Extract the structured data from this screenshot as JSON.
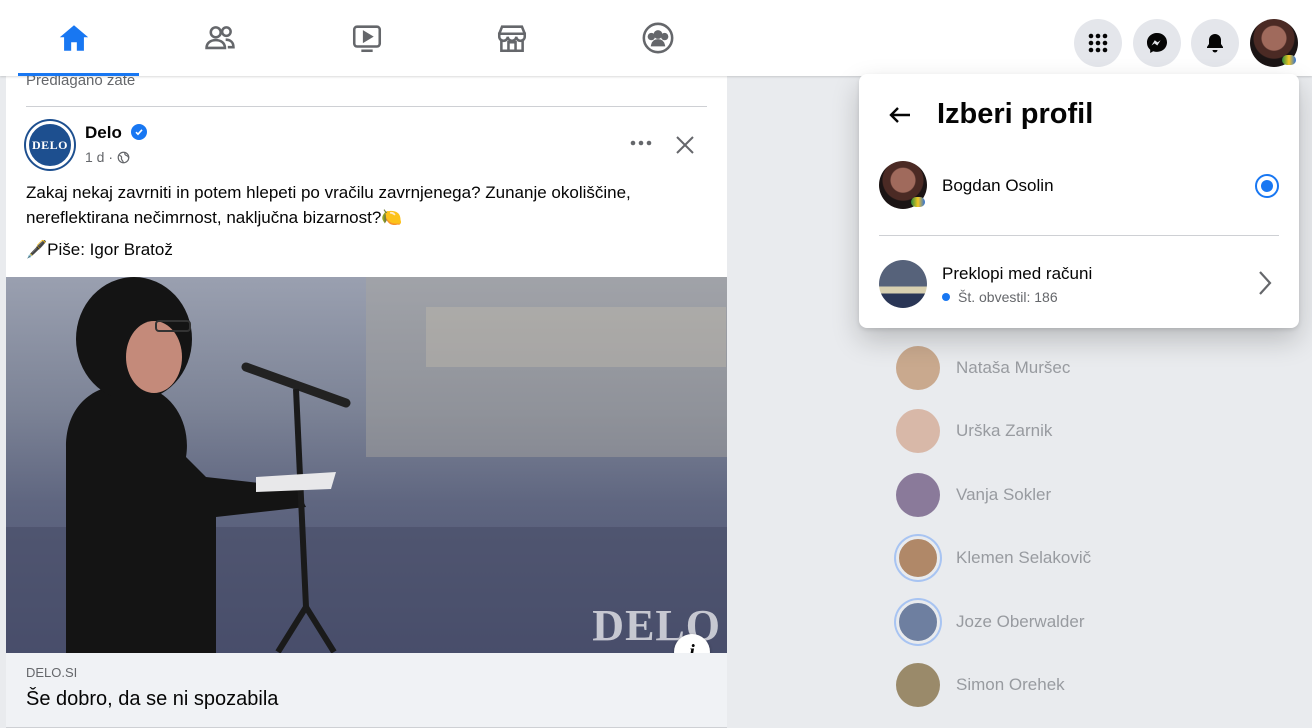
{
  "nav": {
    "tabs": [
      {
        "name": "home",
        "icon": "home-icon",
        "active": true
      },
      {
        "name": "friends",
        "icon": "friends-icon",
        "active": false
      },
      {
        "name": "watch",
        "icon": "watch-icon",
        "active": false
      },
      {
        "name": "marketplace",
        "icon": "marketplace-icon",
        "active": false
      },
      {
        "name": "groups",
        "icon": "groups-icon",
        "active": false
      }
    ],
    "right_buttons": [
      "menu-grid-icon",
      "messenger-icon",
      "notifications-bell-icon",
      "account-avatar"
    ],
    "accent_color": "#1877f2"
  },
  "post": {
    "section_label": "Predlagano zate",
    "page_name": "Delo",
    "page_logo_text": "DELO",
    "time": "1 d ·",
    "text": "Zakaj nekaj zavrniti in potem hlepeti po vračilu zavrnjenega? Zunanje okoliščine, nereflektirana nečimrnost, naključna bizarnost?🍋",
    "byline": "🖋️Piše: Igor Bratož",
    "image_watermark": "DELO",
    "info_label": "i",
    "link_domain": "DELO.SI",
    "link_title": "Še dobro, da se ni spozabila"
  },
  "dropdown": {
    "title": "Izberi profil",
    "profile_name": "Bogdan Osolin",
    "profile_selected": true,
    "switch_label": "Preklopi med računi",
    "notifications": "Št. obvestil: 186"
  },
  "contacts": [
    {
      "name": "Nataša Muršec",
      "ring": false,
      "color": "#c9a98e"
    },
    {
      "name": "Urška Zarnik",
      "ring": false,
      "color": "#d8b8a8"
    },
    {
      "name": "Vanja Sokler",
      "ring": false,
      "color": "#8a7a9a"
    },
    {
      "name": "Klemen Selakovič",
      "ring": true,
      "color": "#b08868"
    },
    {
      "name": "Joze Oberwalder",
      "ring": true,
      "color": "#6e7fa0"
    },
    {
      "name": "Simon Orehek",
      "ring": false,
      "color": "#9a8a6a"
    }
  ]
}
